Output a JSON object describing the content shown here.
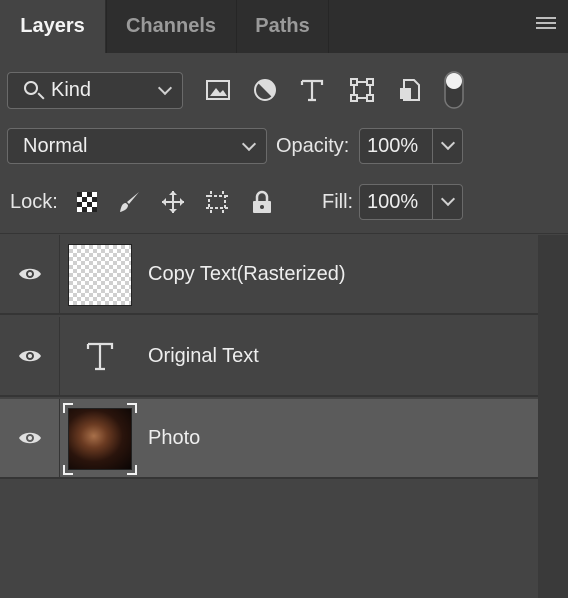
{
  "tabs": [
    {
      "label": "Layers",
      "active": true
    },
    {
      "label": "Channels",
      "active": false
    },
    {
      "label": "Paths",
      "active": false
    }
  ],
  "panel_menu_icon": "hamburger-icon",
  "filter": {
    "kind_label": "Kind",
    "icons": [
      "image-filter-icon",
      "adjustment-filter-icon",
      "type-filter-icon",
      "shape-filter-icon",
      "smart-object-filter-icon",
      "filter-toggle-icon"
    ]
  },
  "blend": {
    "mode": "Normal",
    "opacity_label": "Opacity:",
    "opacity_value": "100%"
  },
  "lock": {
    "label": "Lock:",
    "icons": [
      "lock-transparent-icon",
      "lock-image-icon",
      "lock-position-icon",
      "lock-artboard-icon",
      "lock-all-icon"
    ],
    "fill_label": "Fill:",
    "fill_value": "100%"
  },
  "layers": [
    {
      "name": "Copy Text(Rasterized)",
      "visible": true,
      "thumb": "transparent-checker",
      "selected": false
    },
    {
      "name": "Original Text",
      "visible": true,
      "thumb": "type-icon",
      "selected": false
    },
    {
      "name": "Photo",
      "visible": true,
      "thumb": "photo",
      "selected": true
    }
  ],
  "colors": {
    "panel_bg": "#444444",
    "tabbar_bg": "#2e2e2e",
    "selected_row": "#5b5b5b"
  }
}
